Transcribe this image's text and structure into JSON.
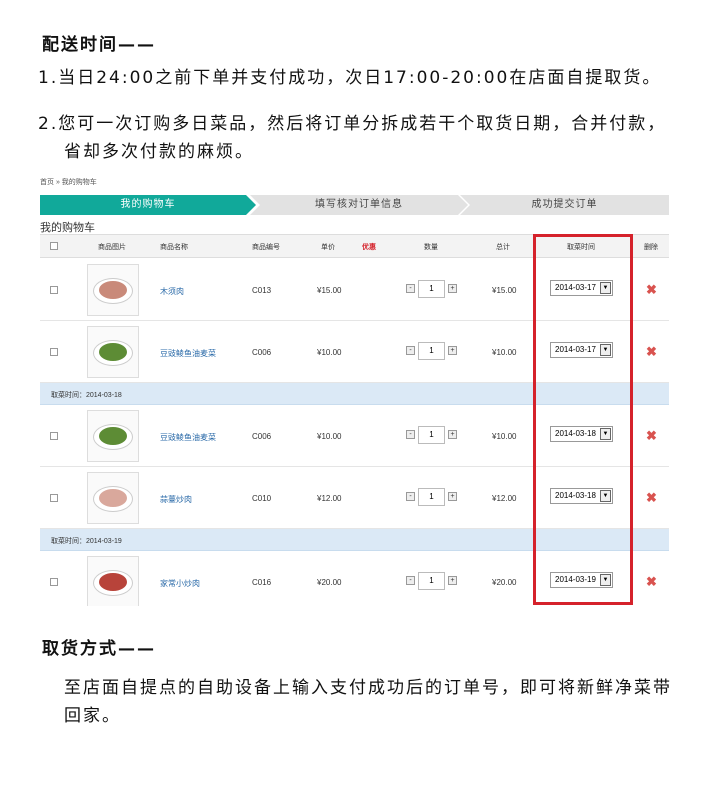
{
  "delivery": {
    "heading": "配送时间——",
    "line1": "1.当日24:00之前下单并支付成功，次日17:00-20:00在店面自提取货。",
    "line2a": "2.您可一次订购多日菜品，然后将订单分拆成若干个取货日期，合并付款，",
    "line2b": "省却多次付款的麻烦。"
  },
  "cart": {
    "breadcrumb": "首页 » 我的购物车",
    "steps": [
      "我的购物车",
      "填写核对订单信息",
      "成功提交订单"
    ],
    "title": "我的购物车",
    "columns": {
      "image": "商品图片",
      "name": "商品名称",
      "code": "商品编号",
      "price": "单价",
      "discount": "优惠",
      "qty": "数量",
      "total": "总计",
      "pickup": "取菜时间",
      "delete": "删除"
    },
    "rows": [
      {
        "name": "木须肉",
        "code": "C013",
        "price": "¥15.00",
        "qty": "1",
        "total": "¥15.00",
        "date": "2014-03-17"
      },
      {
        "name": "豆豉鲮鱼油麦菜",
        "code": "C006",
        "price": "¥10.00",
        "qty": "1",
        "total": "¥10.00",
        "date": "2014-03-17"
      },
      {
        "name": "豆豉鲮鱼油麦菜",
        "code": "C006",
        "price": "¥10.00",
        "qty": "1",
        "total": "¥10.00",
        "date": "2014-03-18"
      },
      {
        "name": "蒜薹炒肉",
        "code": "C010",
        "price": "¥12.00",
        "qty": "1",
        "total": "¥12.00",
        "date": "2014-03-18"
      },
      {
        "name": "家常小炒肉",
        "code": "C016",
        "price": "¥20.00",
        "qty": "1",
        "total": "¥20.00",
        "date": "2014-03-19"
      }
    ],
    "groups": [
      "取菜时间：2014-03-18",
      "取菜时间：2014-03-19"
    ],
    "qty_minus": "-",
    "qty_plus": "+",
    "delete_glyph": "✖",
    "dropdown_glyph": "▼"
  },
  "pickup": {
    "heading": "取货方式——",
    "line1": "至店面自提点的自助设备上输入支付成功后的订单号，即可将新鲜净菜带",
    "line2": "回家。"
  },
  "colors": {
    "accent": "#11a99a",
    "highlight_box": "#d5222b",
    "group_bg": "#dbe9f6",
    "discount": "#d5222b"
  }
}
